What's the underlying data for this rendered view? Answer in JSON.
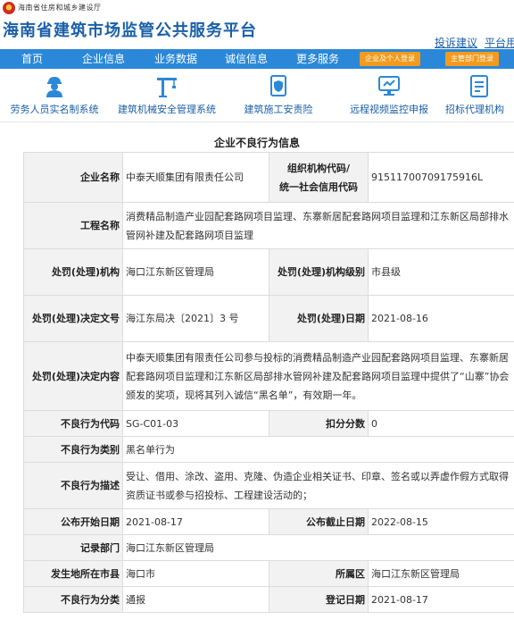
{
  "header": {
    "department": "海南省住房和城乡建设厅",
    "site_title": "海南省建筑市场监管公共服务平台",
    "links": [
      "投诉建议",
      "平台用"
    ]
  },
  "nav": {
    "items": [
      "首页",
      "企业信息",
      "业务数据",
      "诚信信息",
      "更多服务"
    ],
    "buttons": [
      "企业及个人登录",
      "主管部门登录"
    ],
    "colors": {
      "bar": "#2b88d8",
      "button": "#f29b1e"
    }
  },
  "icon_bar": [
    {
      "label": "劳务人员实名制系统",
      "icon": "worker-icon"
    },
    {
      "label": "建筑机械安全管理系统",
      "icon": "crane-icon"
    },
    {
      "label": "建筑施工安责险",
      "icon": "shield-document-icon"
    },
    {
      "label": "远程视频监控申报",
      "icon": "monitor-icon"
    },
    {
      "label": "招标代理机构",
      "icon": "document-icon"
    }
  ],
  "section_title": "企业不良行为信息",
  "record": {
    "company_name_label": "企业名称",
    "company_name": "中泰天顺集团有限责任公司",
    "org_code_label": "组织机构代码/\n统一社会信用代码",
    "org_code": "91511700709175916L",
    "project_label": "工程名称",
    "project": "消费精品制造产业园配套路网项目监理、东寨新居配套路网项目监理和江东新区局部排水管网补建及配套路网项目监理",
    "authority_label": "处罚(处理)机构",
    "authority": "海口江东新区管理局",
    "authority_level_label": "处罚(处理)机构级别",
    "authority_level": "市县级",
    "decision_no_label": "处罚(处理)决定文号",
    "decision_no": "海江东局决〔2021〕3 号",
    "decision_date_label": "处罚(处理)日期",
    "decision_date": "2021-08-16",
    "decision_content_label": "处罚(处理)决定内容",
    "decision_content": "中泰天顺集团有限责任公司参与投标的消费精品制造产业园配套路网项目监理、东寨新居配套路网项目监理和江东新区局部排水管网补建及配套路网项目监理中提供了“山寨”协会颁发的奖项，现将其列入诚信“黑名单”，有效期一年。",
    "behavior_code_label": "不良行为代码",
    "behavior_code": "SG-C01-03",
    "deduction_label": "扣分分数",
    "deduction": "0",
    "behavior_type_label": "不良行为类别",
    "behavior_type": "黑名单行为",
    "behavior_desc_label": "不良行为描述",
    "behavior_desc": "受让、借用、涂改、盗用、克隆、伪造企业相关证书、印章、签名或以弄虚作假方式取得资质证书或参与招投标、工程建设活动的；",
    "publish_start_label": "公布开始日期",
    "publish_start": "2021-08-17",
    "publish_end_label": "公布截止日期",
    "publish_end": "2022-08-15",
    "record_dept_label": "记录部门",
    "record_dept": "海口江东新区管理局",
    "city_label": "发生地所在市县",
    "city": "海口市",
    "area_label": "所属区",
    "area": "海口江东新区管理局",
    "category_label": "不良行为分类",
    "category": "通报",
    "register_date_label": "登记日期",
    "register_date": "2021-08-17"
  }
}
